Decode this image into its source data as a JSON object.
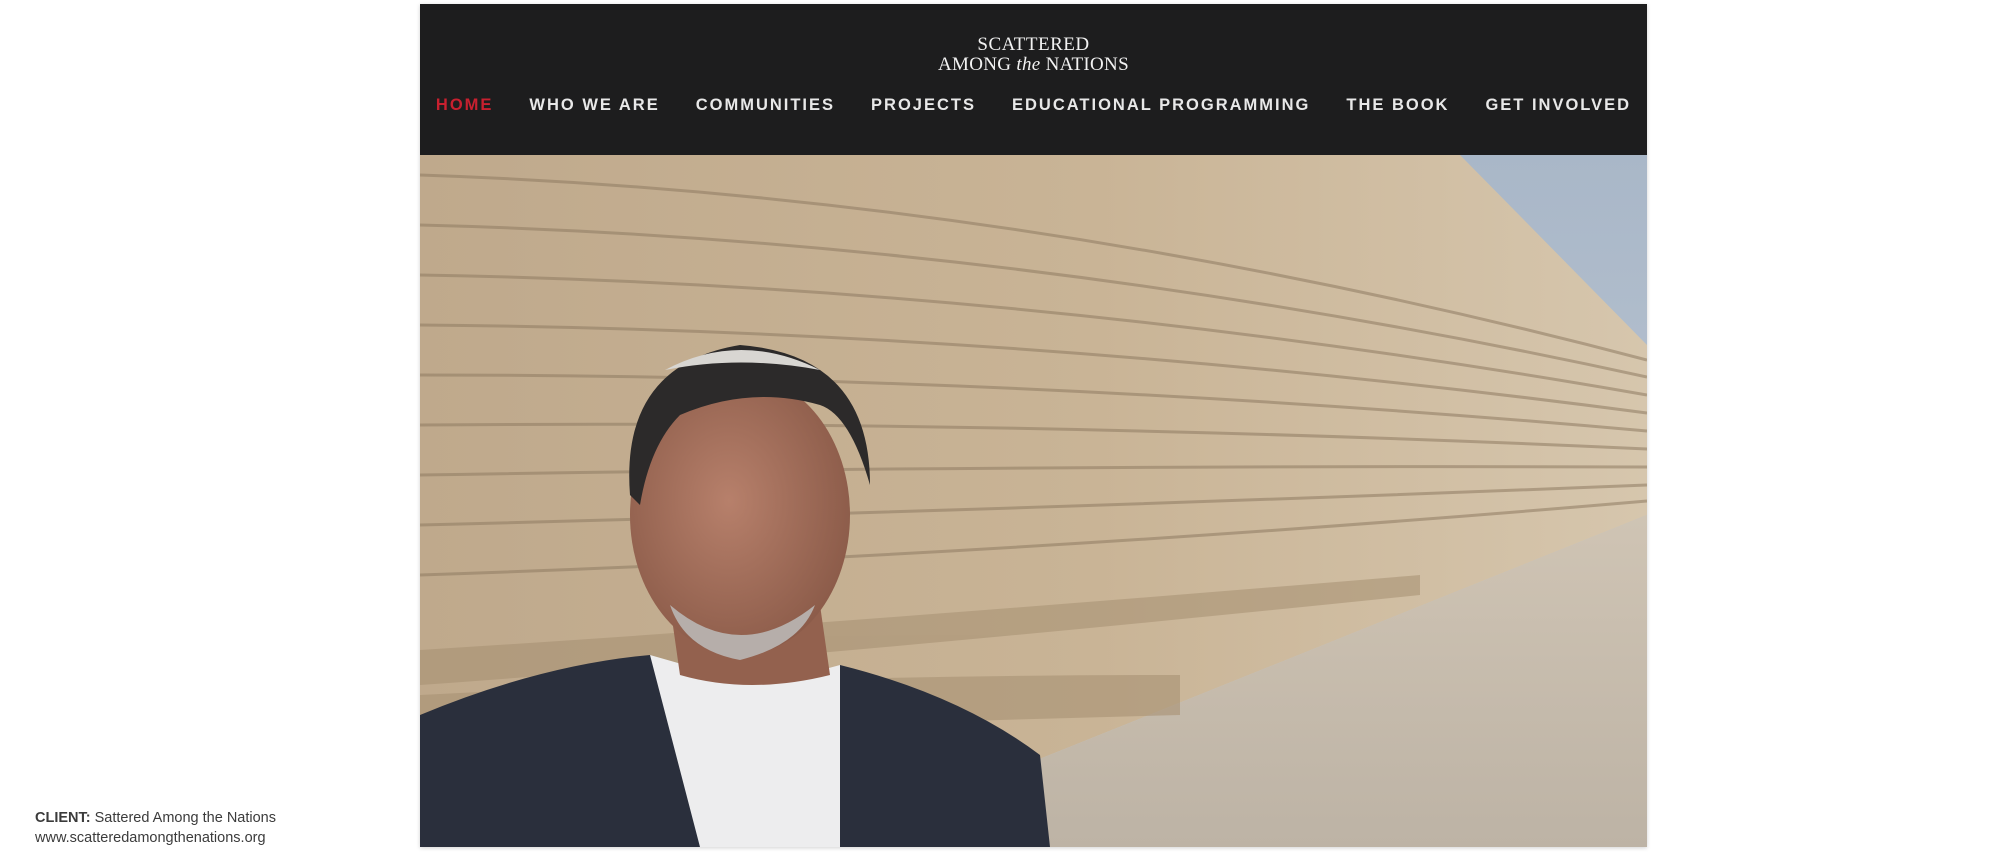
{
  "site": {
    "logo_top": "SCATTERED",
    "logo_among": "AMONG",
    "logo_the": "the",
    "logo_nations": "NATIONS"
  },
  "nav": {
    "items": [
      {
        "label": "HOME",
        "active": true
      },
      {
        "label": "WHO WE ARE",
        "active": false
      },
      {
        "label": "COMMUNITIES",
        "active": false
      },
      {
        "label": "PROJECTS",
        "active": false
      },
      {
        "label": "EDUCATIONAL PROGRAMMING",
        "active": false
      },
      {
        "label": "THE BOOK",
        "active": false
      },
      {
        "label": "GET INVOLVED",
        "active": false
      }
    ]
  },
  "colors": {
    "header_bg": "#1d1d1e",
    "nav_active": "#c8202f",
    "nav_text": "#e8e8e8"
  },
  "caption": {
    "label": "CLIENT:",
    "client_name": "Sattered Among the Nations",
    "url": "www.scatteredamongthenations.org"
  }
}
